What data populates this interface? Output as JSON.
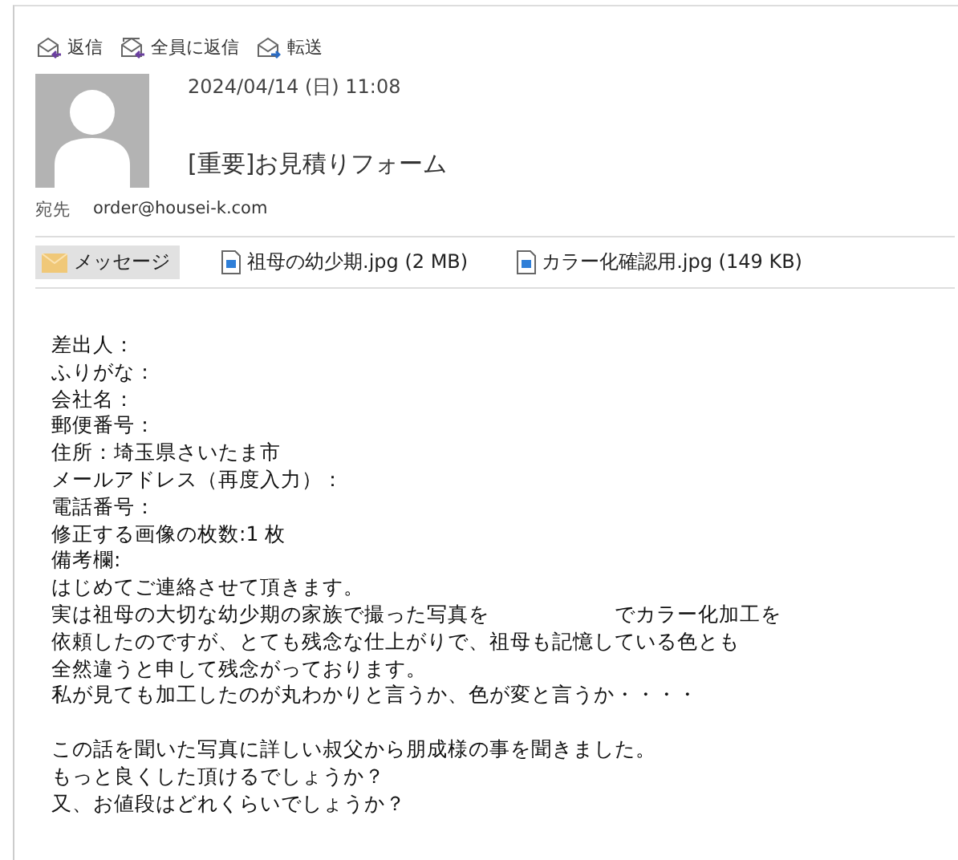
{
  "toolbar": [
    {
      "kind": "reply",
      "label": "返信"
    },
    {
      "kind": "reply_all",
      "label": "全員に返信"
    },
    {
      "kind": "forward",
      "label": "転送"
    }
  ],
  "header": {
    "date": "2024/04/14 (日) 11:08",
    "subject": "[重要]お見積りフォーム",
    "to_label": "宛先",
    "to": "order@housei-k.com"
  },
  "attachments": [
    {
      "kind": "message",
      "label": "メッセージ",
      "selected": true
    },
    {
      "kind": "file",
      "label": "祖母の幼少期.jpg (2 MB)",
      "selected": false
    },
    {
      "kind": "file",
      "label": "カラー化確認用.jpg (149 KB)",
      "selected": false
    }
  ],
  "body": {
    "paragraphs": [
      [
        "差出人：",
        "ふりがな：",
        "会社名：",
        "郵便番号：",
        "住所：埼玉県さいたま市",
        "メールアドレス（再度入力）：",
        "電話番号：",
        "修正する画像の枚数:1 枚",
        "備考欄:",
        "はじめてご連絡させて頂きます。",
        "実は祖母の大切な幼少期の家族で撮った写真を　　　　　　でカラー化加工を",
        "依頼したのですが、とても残念な仕上がりで、祖母も記憶している色とも",
        "全然違うと申して残念がっております。",
        "私が見ても加工したのが丸わかりと言うか、色が変と言うか・・・・"
      ],
      [
        "この話を聞いた写真に詳しい叔父から朋成様の事を聞きました。",
        "もっと良くした頂けるでしょうか？",
        "又、お値段はどれくらいでしょうか？"
      ]
    ]
  }
}
